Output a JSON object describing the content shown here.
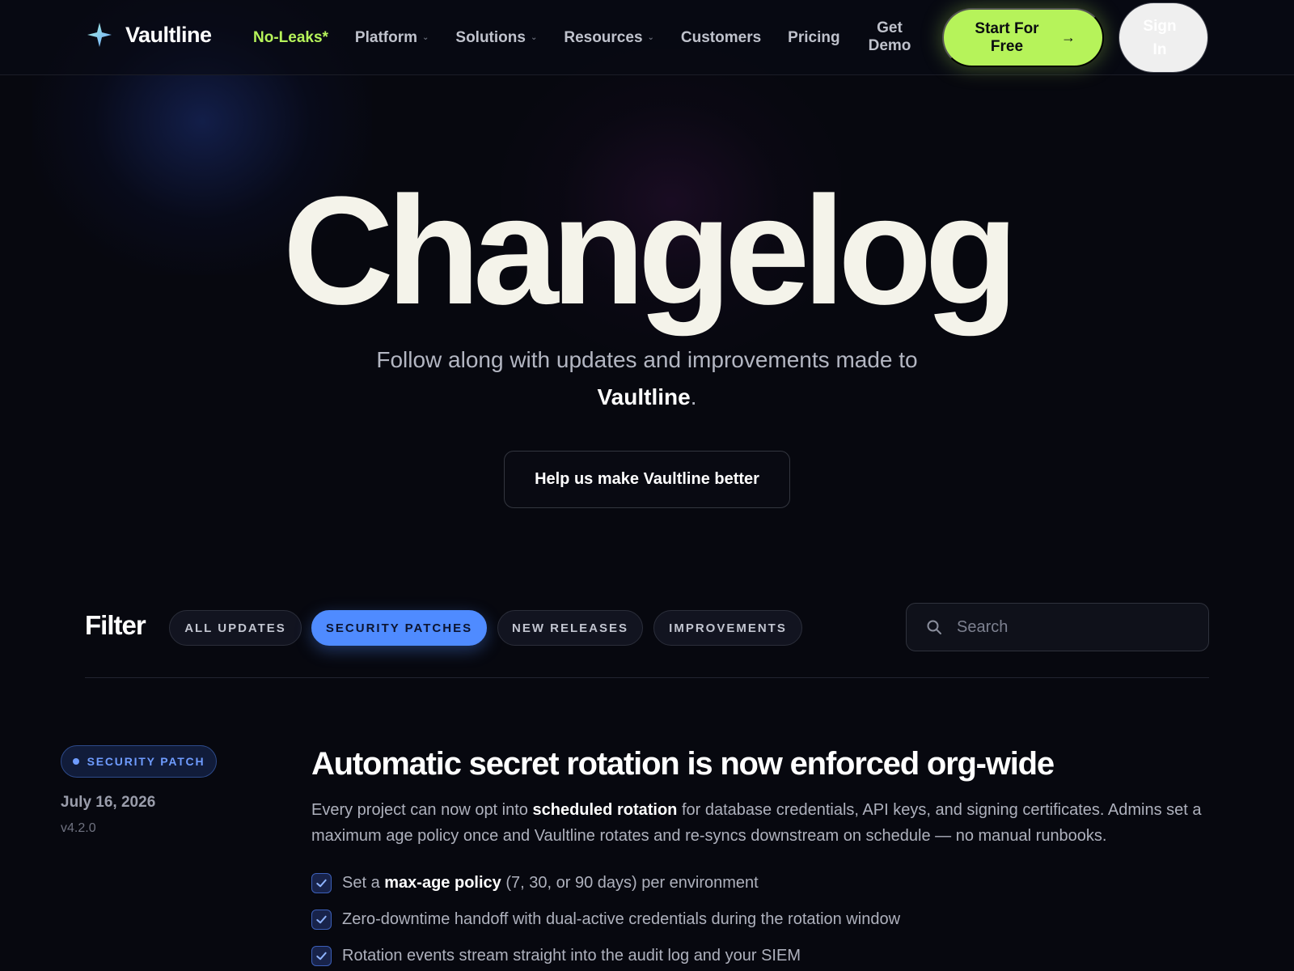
{
  "nav": {
    "brand": "Vaultline",
    "links": [
      {
        "label": "No-Leaks*",
        "accent": true,
        "dropdown": false
      },
      {
        "label": "Platform",
        "dropdown": true
      },
      {
        "label": "Solutions",
        "dropdown": true
      },
      {
        "label": "Resources",
        "dropdown": true
      },
      {
        "label": "Customers",
        "dropdown": false
      },
      {
        "label": "Pricing",
        "dropdown": false
      }
    ],
    "get_demo": "Get Demo",
    "start_free": "Start For Free",
    "sign_in": "Sign In"
  },
  "hero": {
    "title": "Changelog",
    "subtitle": "Follow along with updates and improvements made to",
    "subtitle_brand": "Vaultline",
    "subtitle_end": ".",
    "cta": "Help us make Vaultline better"
  },
  "filter": {
    "label": "Filter",
    "chips": [
      "ALL UPDATES",
      "SECURITY PATCHES",
      "NEW RELEASES",
      "IMPROVEMENTS"
    ],
    "active": "SECURITY PATCHES",
    "search_placeholder": "Search"
  },
  "entry": {
    "badge": "SECURITY PATCH",
    "date": "July 16, 2026",
    "version": "v4.2.0",
    "title": "Automatic secret rotation is now enforced org-wide",
    "body_pre": "Every project can now opt into",
    "body_bold": "scheduled rotation",
    "body_post": "for database credentials, API keys, and signing certificates. Admins set a maximum age policy once and Vaultline rotates and re-syncs downstream on schedule — no manual runbooks.",
    "checks": [
      {
        "pre": "Set a",
        "bold": "max-age policy",
        "post": "(7, 30, or 90 days) per environment"
      },
      {
        "pre": "Zero-downtime handoff with dual-active credentials during the rotation window",
        "bold": "",
        "post": ""
      },
      {
        "pre": "Rotation events stream straight into the audit log and your SIEM",
        "bold": "",
        "post": ""
      }
    ]
  },
  "colors": {
    "accent_green": "#b6f35a",
    "accent_blue": "#4f8bff",
    "background": "#07080f"
  }
}
